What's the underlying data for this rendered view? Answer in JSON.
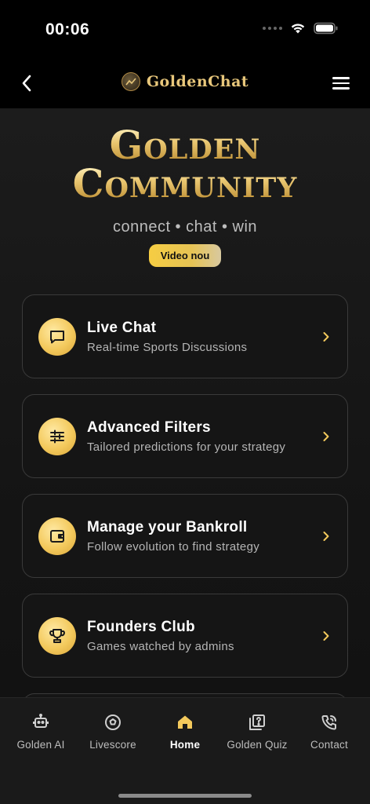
{
  "status": {
    "time": "00:06"
  },
  "nav": {
    "brand": "GoldenChat"
  },
  "hero": {
    "title_line1": "Golden",
    "title_line2": "Community",
    "tagline": "connect • chat • win",
    "badge": "Video nou"
  },
  "cards": [
    {
      "title": "Live Chat",
      "subtitle": "Real-time Sports Discussions",
      "icon": "chat-icon"
    },
    {
      "title": "Advanced Filters",
      "subtitle": "Tailored predictions for your strategy",
      "icon": "sliders-icon"
    },
    {
      "title": "Manage your Bankroll",
      "subtitle": "Follow evolution to find strategy",
      "icon": "wallet-icon"
    },
    {
      "title": "Founders Club",
      "subtitle": "Games watched by admins",
      "icon": "trophy-icon"
    }
  ],
  "tabs": [
    {
      "label": "Golden AI",
      "icon": "robot-icon",
      "active": false
    },
    {
      "label": "Livescore",
      "icon": "soccer-ball-icon",
      "active": false
    },
    {
      "label": "Home",
      "icon": "home-icon",
      "active": true
    },
    {
      "label": "Golden Quiz",
      "icon": "quiz-icon",
      "active": false
    },
    {
      "label": "Contact",
      "icon": "phone-icon",
      "active": false
    }
  ],
  "colors": {
    "gold": "#f3c95c",
    "accent_text": "#e8c77b",
    "background": "#151515"
  }
}
